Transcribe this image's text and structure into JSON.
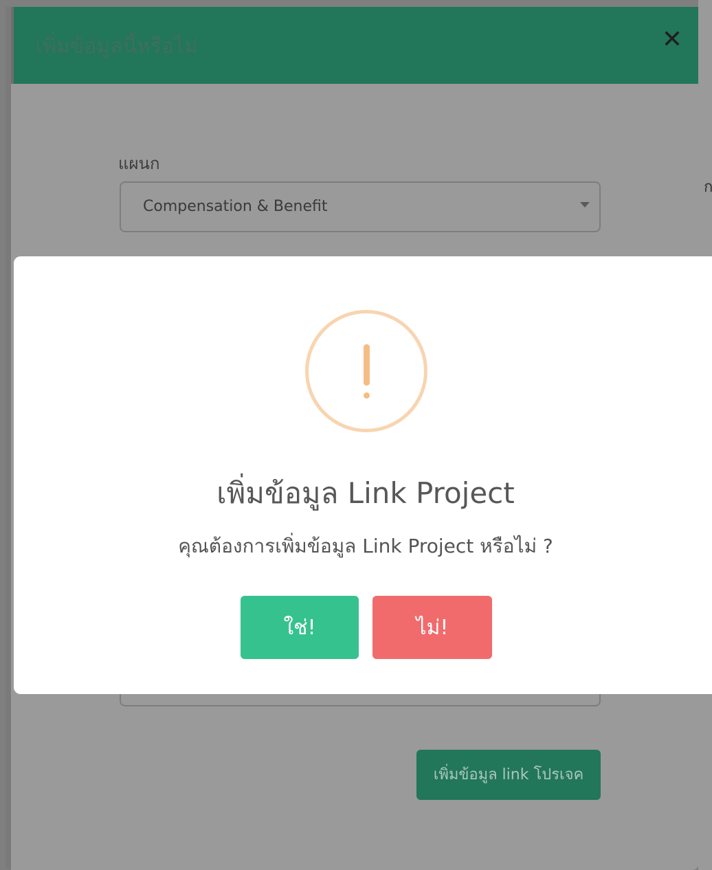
{
  "background_page": {
    "strip_glyph": "ก"
  },
  "modal": {
    "title": "เพิ่มข้อมูลนี้หรือไม่",
    "close_label": "✕",
    "department_label": "แผนก",
    "department_select": {
      "selected": "Compensation & Benefit"
    },
    "link_button_label": "เพิ่มข้อมูล link โปรเจค"
  },
  "alert": {
    "icon": "warning-exclamation-icon",
    "title": "เพิ่มข้อมูล Link Project",
    "text": "คุณต้องการเพิ่มข้อมูล Link Project หรือไม่ ?",
    "confirm_label": "ใช่!",
    "cancel_label": "ไม่!"
  },
  "colors": {
    "header": "#22765a",
    "confirm": "#36c28f",
    "cancel": "#f16b6d",
    "warning": "#f5bd84"
  }
}
